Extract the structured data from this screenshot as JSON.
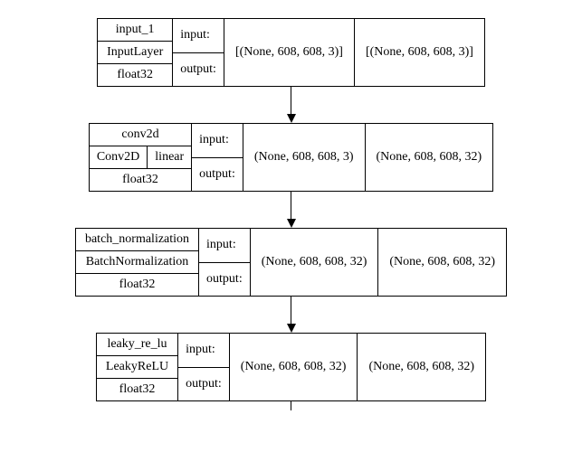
{
  "labels": {
    "input": "input:",
    "output": "output:"
  },
  "nodes": [
    {
      "name": "input_1",
      "class": "InputLayer",
      "activation": null,
      "dtype": "float32",
      "input_shape": "[(None, 608, 608, 3)]",
      "output_shape": "[(None, 608, 608, 3)]"
    },
    {
      "name": "conv2d",
      "class": "Conv2D",
      "activation": "linear",
      "dtype": "float32",
      "input_shape": "(None, 608, 608, 3)",
      "output_shape": "(None, 608, 608, 32)"
    },
    {
      "name": "batch_normalization",
      "class": "BatchNormalization",
      "activation": null,
      "dtype": "float32",
      "input_shape": "(None, 608, 608, 32)",
      "output_shape": "(None, 608, 608, 32)"
    },
    {
      "name": "leaky_re_lu",
      "class": "LeakyReLU",
      "activation": null,
      "dtype": "float32",
      "input_shape": "(None, 608, 608, 32)",
      "output_shape": "(None, 608, 608, 32)"
    }
  ]
}
